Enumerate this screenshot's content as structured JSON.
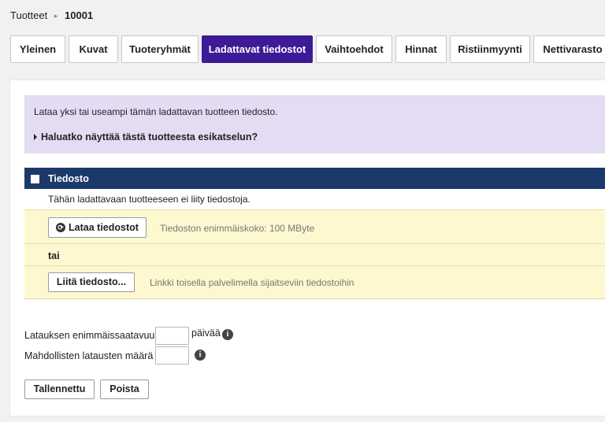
{
  "breadcrumb": {
    "parent": "Tuotteet",
    "separator": "▸",
    "current": "10001"
  },
  "tabs": [
    {
      "label": "Yleinen"
    },
    {
      "label": "Kuvat"
    },
    {
      "label": "Tuoteryhmät"
    },
    {
      "label": "Ladattavat tiedostot",
      "active": true
    },
    {
      "label": "Vaihtoehdot"
    },
    {
      "label": "Hinnat"
    },
    {
      "label": "Ristiinmyynti"
    },
    {
      "label": "Nettivarasto"
    }
  ],
  "info": {
    "text": "Lataa yksi tai useampi tämän ladattavan tuotteen tiedosto.",
    "preview_toggle": "Haluatko näyttää tästä tuotteesta esikatselun?"
  },
  "table": {
    "header": "Tiedosto",
    "empty_text": "Tähän ladattavaan tuotteeseen ei liity tiedostoja.",
    "upload_button": "Lataa tiedostot",
    "upload_hint": "Tiedoston enimmäiskoko: 100 MByte",
    "or_label": "tai",
    "link_button": "Liitä tiedosto...",
    "link_hint": "Linkki toisella palvelimella sijaitseviin tiedostoihin"
  },
  "fields": {
    "max_availability_label": "Latauksen enimmäissaatavuus",
    "max_availability_value": "",
    "max_availability_unit": "päivää",
    "max_downloads_label": "Mahdollisten latausten määrä",
    "max_downloads_value": ""
  },
  "actions": {
    "save": "Tallennettu",
    "delete": "Poista"
  },
  "colors": {
    "active_tab": "#3d1a96",
    "table_header": "#1b3a6b",
    "info_bg": "#e3dcf3",
    "row_bg": "#fdf8d0"
  }
}
